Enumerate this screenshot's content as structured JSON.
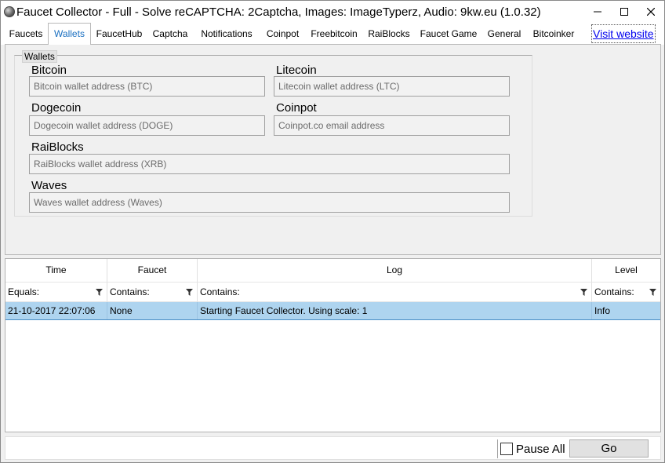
{
  "window": {
    "title": "Faucet Collector - Full - Solve reCAPTCHA: 2Captcha, Images: ImageTyperz, Audio: 9kw.eu (1.0.32)"
  },
  "tabs": [
    {
      "label": "Faucets",
      "selected": false
    },
    {
      "label": "Wallets",
      "selected": true
    },
    {
      "label": "FaucetHub",
      "selected": false
    },
    {
      "label": "Captcha",
      "selected": false
    },
    {
      "label": "Notifications",
      "selected": false
    },
    {
      "label": "Coinpot",
      "selected": false
    },
    {
      "label": "Freebitcoin",
      "selected": false
    },
    {
      "label": "RaiBlocks",
      "selected": false
    },
    {
      "label": "Faucet Game",
      "selected": false
    },
    {
      "label": "General",
      "selected": false
    },
    {
      "label": "Bitcoinker",
      "selected": false
    }
  ],
  "visit_website": "Visit website",
  "wallets": {
    "group_label": "Wallets",
    "bitcoin": {
      "label": "Bitcoin",
      "placeholder": "Bitcoin wallet address (BTC)",
      "value": ""
    },
    "litecoin": {
      "label": "Litecoin",
      "placeholder": "Litecoin wallet address (LTC)",
      "value": ""
    },
    "dogecoin": {
      "label": "Dogecoin",
      "placeholder": "Dogecoin wallet address (DOGE)",
      "value": ""
    },
    "coinpot": {
      "label": "Coinpot",
      "placeholder": "Coinpot.co email address",
      "value": ""
    },
    "raiblocks": {
      "label": "RaiBlocks",
      "placeholder": "RaiBlocks wallet address (XRB)",
      "value": ""
    },
    "waves": {
      "label": "Waves",
      "placeholder": "Waves wallet address (Waves)",
      "value": ""
    }
  },
  "grid": {
    "columns": [
      "Time",
      "Faucet",
      "Log",
      "Level"
    ],
    "filters": [
      "Equals:",
      "Contains:",
      "Contains:",
      "Contains:"
    ],
    "rows": [
      {
        "time": "21-10-2017 22:07:06",
        "faucet": "None",
        "log": "Starting Faucet Collector. Using scale: 1",
        "level": "Info"
      }
    ]
  },
  "bottom": {
    "pause_all": "Pause All",
    "pause_checked": false,
    "go": "Go"
  },
  "icons": {
    "app": "app-icon",
    "minimize": "minimize-icon",
    "maximize": "maximize-icon",
    "close": "close-icon",
    "filter": "filter-icon"
  }
}
